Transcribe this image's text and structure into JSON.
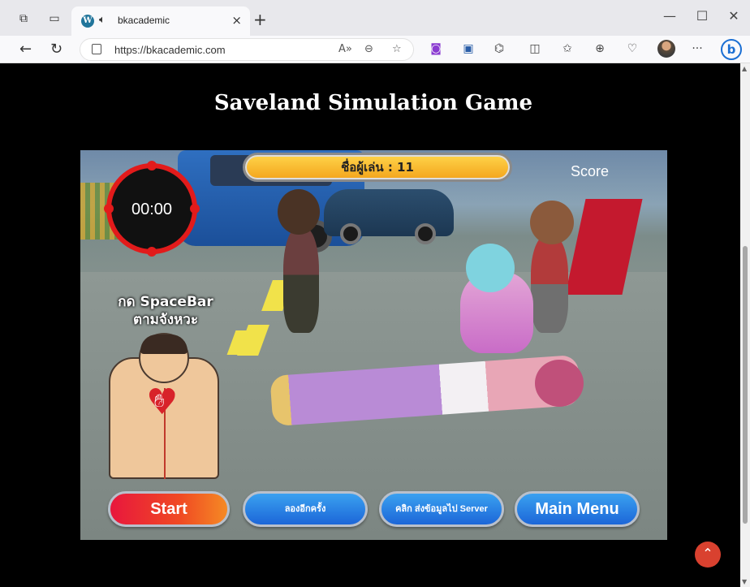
{
  "browser": {
    "tab": {
      "title": "bkacademic",
      "close": "×",
      "audio_icon": "speaker-icon",
      "favicon": "W"
    },
    "new_tab": "+",
    "window": {
      "minimize": "—",
      "maximize": "☐",
      "close": "✕"
    },
    "url": "https://bkacademic.com",
    "read_aloud": "A»",
    "zoom": "⊖",
    "favorite": "☆",
    "more": "···",
    "bing": "b"
  },
  "page": {
    "title": "Saveland Simulation Game"
  },
  "game": {
    "player_label": "ชื่อผู้เล่น : 11",
    "score_label": "Score",
    "timer": "00:00",
    "hint_line1": "กด SpaceBar",
    "hint_line2": "ตามจังหวะ",
    "buttons": {
      "start": "Start",
      "retry": "ลองอีกครั้ง",
      "send": "คลิก ส่งข้อมูลไป Server",
      "main_menu": "Main Menu"
    }
  },
  "scroll_top": "⌃",
  "colors": {
    "timer_ring": "#e21b1b",
    "start_btn": "#e8173d",
    "blue_btn": "#1c66d8",
    "player_bar": "#f3a41b"
  }
}
